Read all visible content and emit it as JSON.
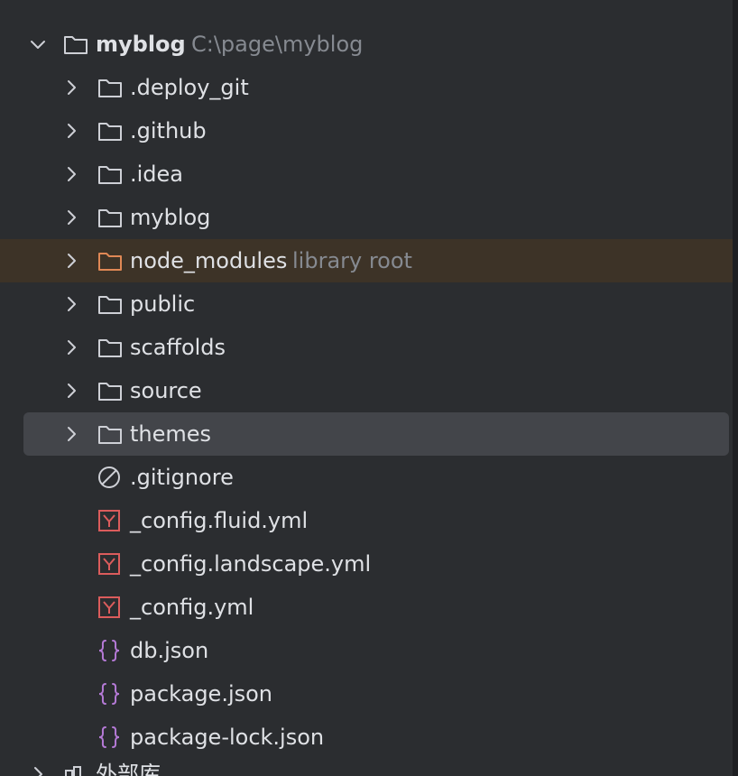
{
  "tree": {
    "root": {
      "label": "myblog",
      "path": "C:\\page\\myblog",
      "icon": "folder-icon",
      "expanded": true
    },
    "folders": [
      {
        "label": ".deploy_git",
        "icon": "folder-icon"
      },
      {
        "label": ".github",
        "icon": "folder-icon"
      },
      {
        "label": ".idea",
        "icon": "folder-icon"
      },
      {
        "label": "myblog",
        "icon": "folder-icon"
      },
      {
        "label": "node_modules",
        "hint": "library root",
        "icon": "library-folder-icon"
      },
      {
        "label": "public",
        "icon": "folder-icon"
      },
      {
        "label": "scaffolds",
        "icon": "folder-icon"
      },
      {
        "label": "source",
        "icon": "folder-icon"
      },
      {
        "label": "themes",
        "icon": "folder-icon",
        "selected": true
      }
    ],
    "files": [
      {
        "label": ".gitignore",
        "icon": "ignore-file-icon"
      },
      {
        "label": "_config.fluid.yml",
        "icon": "yaml-file-icon",
        "glyph": "Y"
      },
      {
        "label": "_config.landscape.yml",
        "icon": "yaml-file-icon",
        "glyph": "Y"
      },
      {
        "label": "_config.yml",
        "icon": "yaml-file-icon",
        "glyph": "Y"
      },
      {
        "label": "db.json",
        "icon": "json-file-icon",
        "glyph": "{}"
      },
      {
        "label": "package.json",
        "icon": "json-file-icon",
        "glyph": "{}"
      },
      {
        "label": "package-lock.json",
        "icon": "json-file-icon",
        "glyph": "{}"
      }
    ],
    "external": {
      "label": "外部库",
      "icon": "external-libraries-icon"
    }
  },
  "colors": {
    "background": "#2b2d30",
    "selected_row": "#43454a",
    "library_row": "#3d3327",
    "text": "#dfe1e5",
    "hint_text": "#868a91",
    "yaml_icon": "#db5c5c",
    "json_icon": "#b57ad6",
    "library_folder": "#e08855"
  }
}
